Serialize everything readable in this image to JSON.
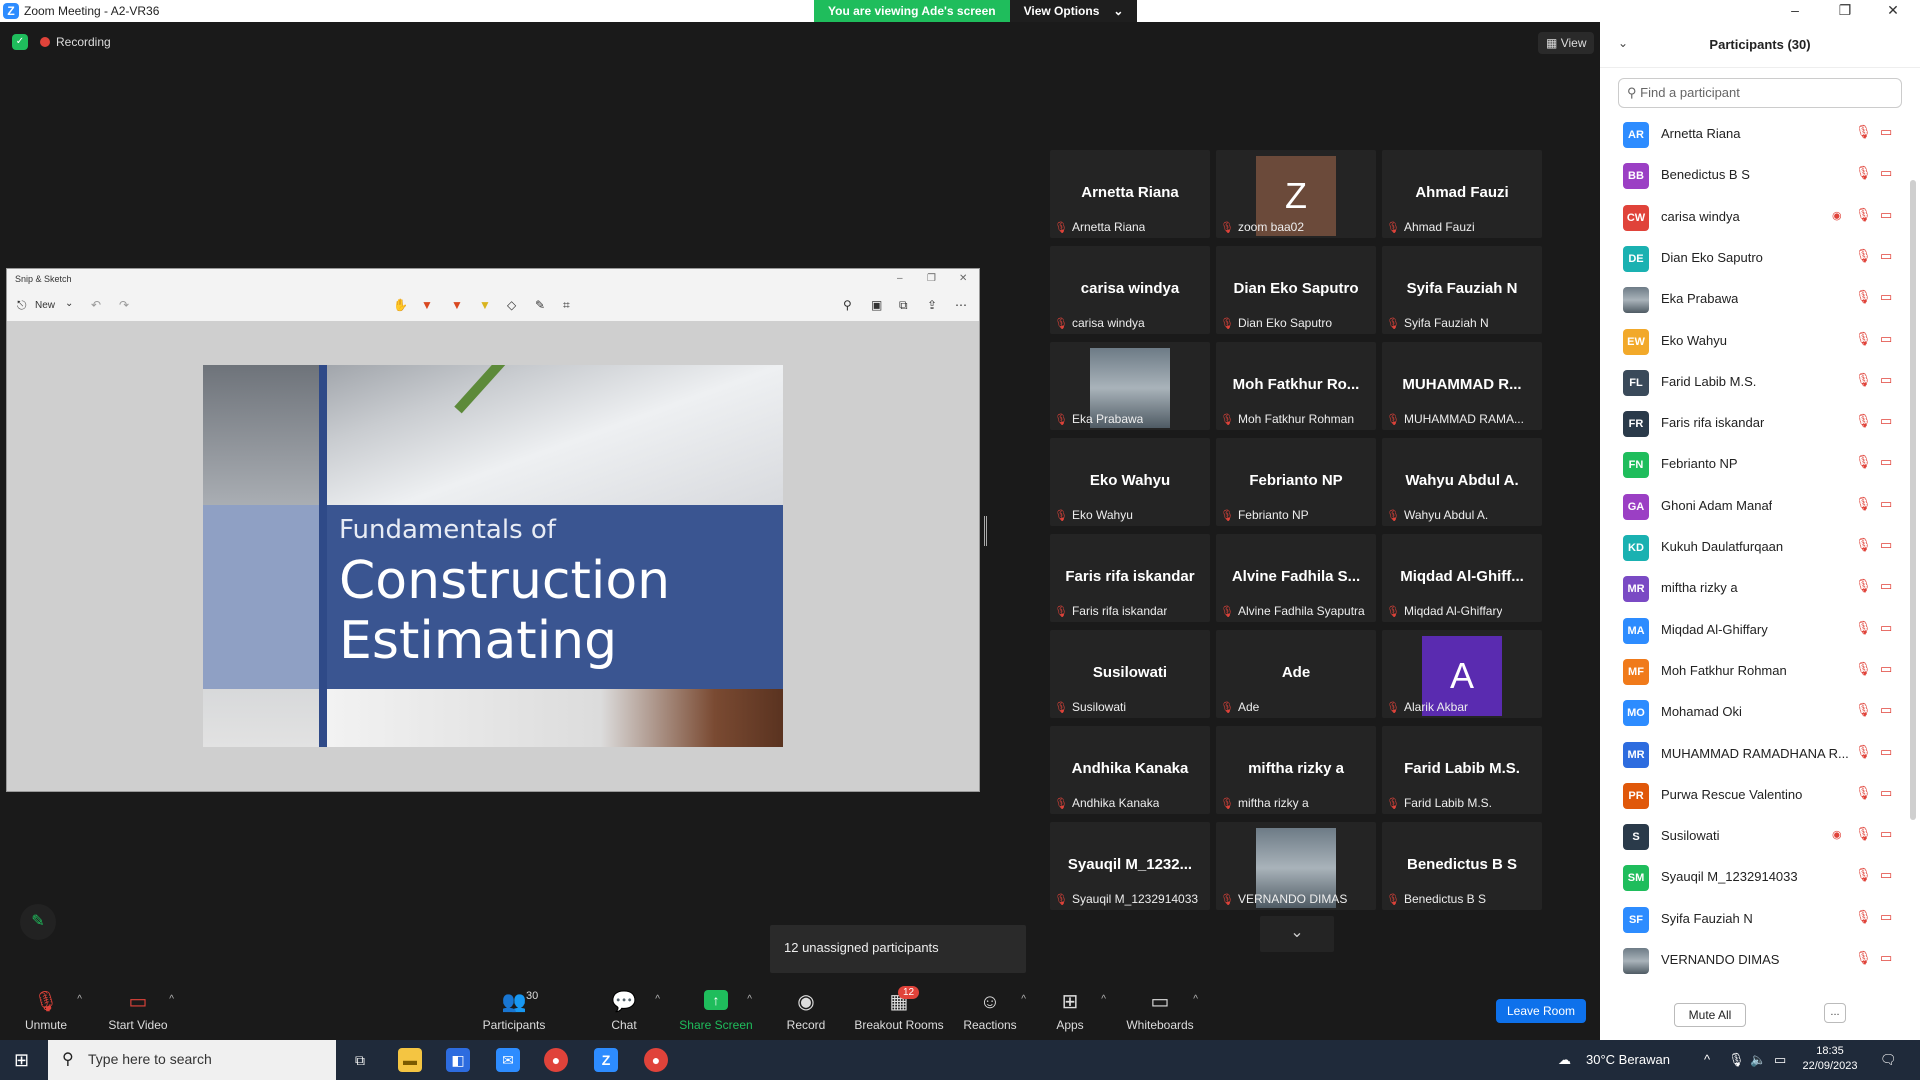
{
  "window": {
    "app_icon": "zoom-icon",
    "title": "Zoom Meeting - A2-VR36"
  },
  "share_banner": {
    "viewing_text": "You are viewing Ade's screen",
    "options_label": "View Options"
  },
  "status": {
    "recording_label": "Recording",
    "view_label": "View"
  },
  "snip_window": {
    "title": "Snip & Sketch",
    "new_label": "New"
  },
  "slide": {
    "subtitle": "Fundamentals of",
    "line1": "Construction",
    "line2": "Estimating"
  },
  "gallery": {
    "tiles": [
      {
        "display": "Arnetta Riana",
        "label": "Arnetta Riana"
      },
      {
        "display": "Z",
        "label": "zoom baa02",
        "avatar_color": "#6b4a3a"
      },
      {
        "display": "Ahmad Fauzi",
        "label": "Ahmad Fauzi"
      },
      {
        "display": "carisa windya",
        "label": "carisa windya"
      },
      {
        "display": "Dian Eko Saputro",
        "label": "Dian Eko Saputro"
      },
      {
        "display": "Syifa Fauziah N",
        "label": "Syifa Fauziah N"
      },
      {
        "display": "",
        "label": "Eka Prabawa",
        "photo": true
      },
      {
        "display": "Moh Fatkhur Ro...",
        "label": "Moh Fatkhur Rohman"
      },
      {
        "display": "MUHAMMAD R...",
        "label": "MUHAMMAD RAMA..."
      },
      {
        "display": "Eko Wahyu",
        "label": "Eko Wahyu"
      },
      {
        "display": "Febrianto NP",
        "label": "Febrianto NP"
      },
      {
        "display": "Wahyu Abdul A.",
        "label": "Wahyu Abdul A."
      },
      {
        "display": "Faris rifa iskandar",
        "label": "Faris rifa iskandar"
      },
      {
        "display": "Alvine Fadhila S...",
        "label": "Alvine Fadhila Syaputra"
      },
      {
        "display": "Miqdad Al-Ghiff...",
        "label": "Miqdad Al-Ghiffary"
      },
      {
        "display": "Susilowati",
        "label": "Susilowati"
      },
      {
        "display": "Ade",
        "label": "Ade"
      },
      {
        "display": "A",
        "label": "Alarik Akbar",
        "avatar_color": "#5a2bb0"
      },
      {
        "display": "Andhika Kanaka",
        "label": "Andhika Kanaka"
      },
      {
        "display": "miftha rizky a",
        "label": "miftha rizky a"
      },
      {
        "display": "Farid Labib M.S.",
        "label": "Farid Labib M.S."
      },
      {
        "display": "Syauqil M_1232...",
        "label": "Syauqil M_1232914033"
      },
      {
        "display": "",
        "label": "VERNANDO DIMAS",
        "photo": true
      },
      {
        "display": "Benedictus B S",
        "label": "Benedictus B S"
      }
    ],
    "unassigned_text": "12 unassigned participants"
  },
  "toolbar": {
    "unmute": "Unmute",
    "start_video": "Start Video",
    "participants": "Participants",
    "participants_count": "30",
    "chat": "Chat",
    "share_screen": "Share Screen",
    "record": "Record",
    "breakout_rooms": "Breakout Rooms",
    "breakout_badge": "12",
    "reactions": "Reactions",
    "apps": "Apps",
    "whiteboards": "Whiteboards",
    "leave_room": "Leave Room"
  },
  "panel": {
    "title": "Participants (30)",
    "search_placeholder": "Find a participant",
    "participants": [
      {
        "initials": "AR",
        "name": "Arnetta Riana",
        "color": "#2d8cff"
      },
      {
        "initials": "BB",
        "name": "Benedictus B S",
        "color": "#9b3fc4"
      },
      {
        "initials": "CW",
        "name": "carisa windya",
        "color": "#e0433a",
        "recording": true
      },
      {
        "initials": "DE",
        "name": "Dian Eko Saputro",
        "color": "#1ab1b1"
      },
      {
        "initials": "",
        "name": "Eka Prabawa",
        "color": "#556270",
        "photo": true
      },
      {
        "initials": "EW",
        "name": "Eko Wahyu",
        "color": "#f2a92a"
      },
      {
        "initials": "FL",
        "name": "Farid Labib M.S.",
        "color": "#3a4a5a"
      },
      {
        "initials": "FR",
        "name": "Faris rifa iskandar",
        "color": "#2a3a4a"
      },
      {
        "initials": "FN",
        "name": "Febrianto NP",
        "color": "#1fbd5c"
      },
      {
        "initials": "GA",
        "name": "Ghoni Adam Manaf",
        "color": "#9b3fc4"
      },
      {
        "initials": "KD",
        "name": "Kukuh Daulatfurqaan",
        "color": "#1ab1b1"
      },
      {
        "initials": "MR",
        "name": "miftha rizky a",
        "color": "#7a4ac4"
      },
      {
        "initials": "MA",
        "name": "Miqdad Al-Ghiffary",
        "color": "#2d8cff"
      },
      {
        "initials": "MF",
        "name": "Moh Fatkhur Rohman",
        "color": "#f07a1a"
      },
      {
        "initials": "MO",
        "name": "Mohamad Oki",
        "color": "#2d8cff"
      },
      {
        "initials": "MR",
        "name": "MUHAMMAD RAMADHANA R...",
        "color": "#2d6cdf"
      },
      {
        "initials": "PR",
        "name": "Purwa Rescue Valentino",
        "color": "#e0580a"
      },
      {
        "initials": "S",
        "name": "Susilowati",
        "color": "#2a3a4a",
        "recording": true
      },
      {
        "initials": "SM",
        "name": "Syauqil M_1232914033",
        "color": "#1fbd5c"
      },
      {
        "initials": "SF",
        "name": "Syifa Fauziah N",
        "color": "#2d8cff"
      },
      {
        "initials": "",
        "name": "VERNANDO DIMAS",
        "color": "#5a7a4a",
        "photo": true
      }
    ],
    "mute_all": "Mute All",
    "more": "..."
  },
  "taskbar": {
    "search_placeholder": "Type here to search",
    "weather": "30°C  Berawan",
    "time": "18:35",
    "date": "22/09/2023"
  }
}
